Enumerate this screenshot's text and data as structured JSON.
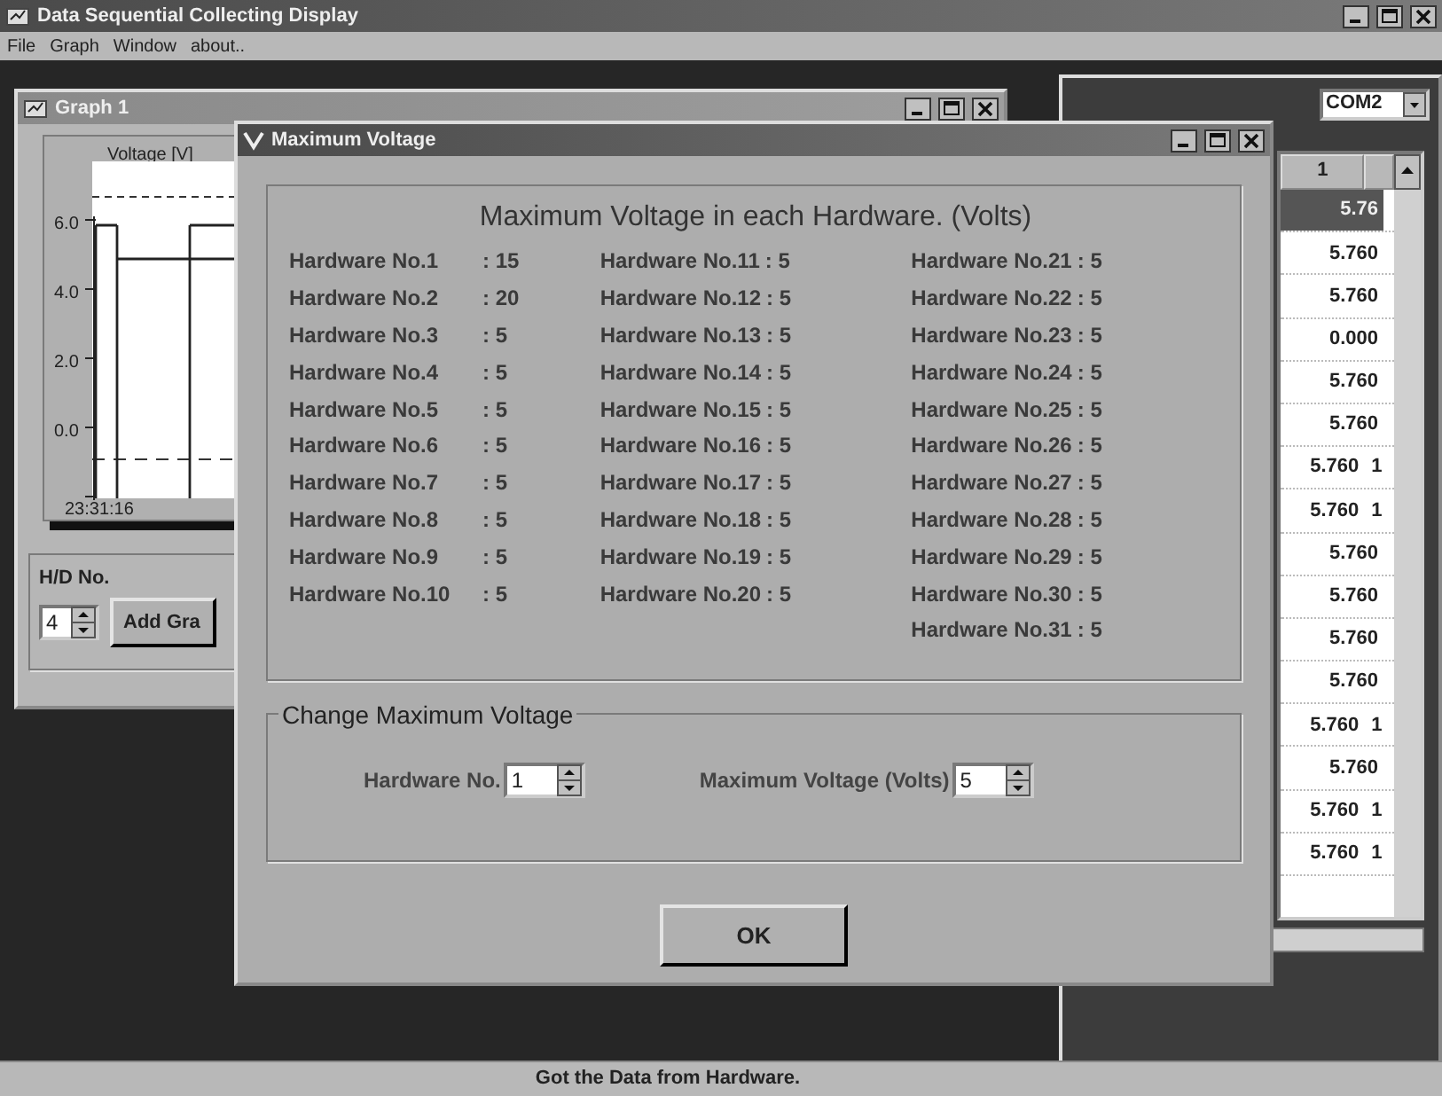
{
  "app": {
    "title": "Data Sequential Collecting Display",
    "menu": [
      "File",
      "Graph",
      "Window",
      "about.."
    ]
  },
  "graph_window": {
    "title": "Graph 1",
    "y_axis_label": "Voltage [V]",
    "y_ticks": [
      "6.0",
      "4.0",
      "2.0",
      "0.0"
    ],
    "x_tick": "23:31:16",
    "hd_label": "H/D No.",
    "hd_value": "4",
    "add_button": "Add Gra"
  },
  "data_window": {
    "port": "COM2",
    "column_header": "1",
    "rows": [
      {
        "value": "5.76",
        "selected": true
      },
      {
        "value": "5.760",
        "selected": false
      },
      {
        "value": "5.760",
        "selected": false
      },
      {
        "value": "0.000",
        "selected": false
      },
      {
        "value": "5.760",
        "selected": false
      },
      {
        "value": "5.760",
        "selected": false
      },
      {
        "value": "5.760",
        "flag": "1",
        "selected": false
      },
      {
        "value": "5.760",
        "flag": "1",
        "selected": false
      },
      {
        "value": "5.760",
        "selected": false
      },
      {
        "value": "5.760",
        "selected": false
      },
      {
        "value": "5.760",
        "selected": false
      },
      {
        "value": "5.760",
        "selected": false
      },
      {
        "value": "5.760",
        "flag": "1",
        "selected": false
      },
      {
        "value": "5.760",
        "selected": false
      },
      {
        "value": "5.760",
        "flag": "1",
        "selected": false
      },
      {
        "value": "5.760",
        "flag": "1",
        "selected": false
      }
    ]
  },
  "dialog": {
    "title": "Maximum Voltage",
    "heading": "Maximum Voltage in each Hardware. (Volts)",
    "columns": [
      [
        {
          "label": "Hardware No.1",
          "value": ": 15"
        },
        {
          "label": "Hardware No.2",
          "value": ": 20"
        },
        {
          "label": "Hardware No.3",
          "value": ": 5"
        },
        {
          "label": "Hardware No.4",
          "value": ": 5"
        },
        {
          "label": "Hardware No.5",
          "value": ": 5"
        },
        {
          "label": "Hardware No.6",
          "value": ": 5"
        },
        {
          "label": "Hardware No.7",
          "value": ": 5"
        },
        {
          "label": "Hardware No.8",
          "value": ": 5"
        },
        {
          "label": "Hardware No.9",
          "value": ": 5"
        },
        {
          "label": "Hardware No.10",
          "value": ": 5"
        }
      ],
      [
        {
          "label": "Hardware No.11",
          "value": ": 5"
        },
        {
          "label": "Hardware No.12",
          "value": ": 5"
        },
        {
          "label": "Hardware No.13",
          "value": ": 5"
        },
        {
          "label": "Hardware No.14",
          "value": ": 5"
        },
        {
          "label": "Hardware No.15",
          "value": ": 5"
        },
        {
          "label": "Hardware No.16",
          "value": ": 5"
        },
        {
          "label": "Hardware No.17",
          "value": ": 5"
        },
        {
          "label": "Hardware No.18",
          "value": ": 5"
        },
        {
          "label": "Hardware No.19",
          "value": ": 5"
        },
        {
          "label": "Hardware No.20",
          "value": ": 5"
        }
      ],
      [
        {
          "label": "Hardware No.21",
          "value": ": 5"
        },
        {
          "label": "Hardware No.22",
          "value": ": 5"
        },
        {
          "label": "Hardware No.23",
          "value": ": 5"
        },
        {
          "label": "Hardware No.24",
          "value": ": 5"
        },
        {
          "label": "Hardware No.25",
          "value": ": 5"
        },
        {
          "label": "Hardware No.26",
          "value": ": 5"
        },
        {
          "label": "Hardware No.27",
          "value": ": 5"
        },
        {
          "label": "Hardware No.28",
          "value": ": 5"
        },
        {
          "label": "Hardware No.29",
          "value": ": 5"
        },
        {
          "label": "Hardware No.30",
          "value": ": 5"
        },
        {
          "label": "Hardware No.31",
          "value": ": 5"
        }
      ]
    ],
    "change_group": {
      "title": "Change Maximum Voltage",
      "hw_label": "Hardware No.",
      "hw_value": "1",
      "volt_label": "Maximum Voltage (Volts)",
      "volt_value": "5"
    },
    "ok": "OK"
  },
  "status_bar": "Got the Data from Hardware."
}
